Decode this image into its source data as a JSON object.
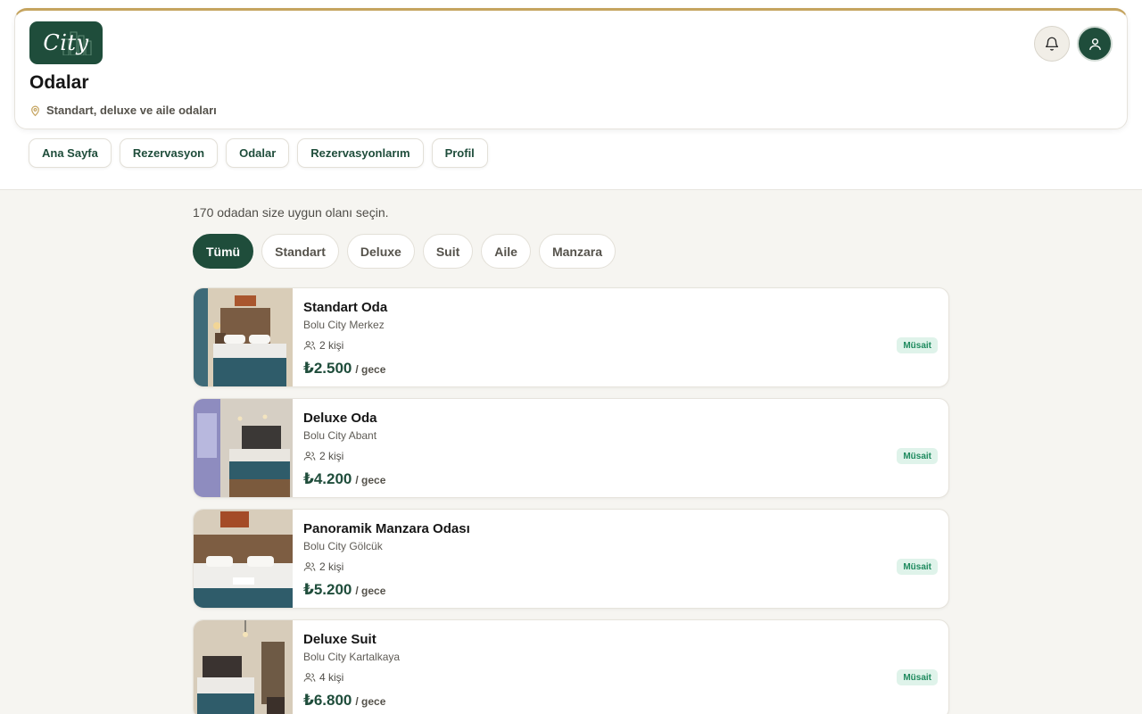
{
  "header": {
    "logo_text": "City",
    "title": "Odalar",
    "subtitle": "Standart, deluxe ve aile odaları"
  },
  "nav": {
    "items": [
      {
        "label": "Ana Sayfa"
      },
      {
        "label": "Rezervasyon"
      },
      {
        "label": "Odalar"
      },
      {
        "label": "Rezervasyonlarım"
      },
      {
        "label": "Profil"
      }
    ]
  },
  "main": {
    "count_text": "170 odadan size uygun olanı seçin.",
    "filters": [
      {
        "label": "Tümü",
        "active": true
      },
      {
        "label": "Standart",
        "active": false
      },
      {
        "label": "Deluxe",
        "active": false
      },
      {
        "label": "Suit",
        "active": false
      },
      {
        "label": "Aile",
        "active": false
      },
      {
        "label": "Manzara",
        "active": false
      }
    ],
    "rooms": [
      {
        "title": "Standart Oda",
        "location": "Bolu City Merkez",
        "capacity": "2 kişi",
        "price": "₺2.500",
        "unit": "/ gece",
        "status": "Müsait"
      },
      {
        "title": "Deluxe Oda",
        "location": "Bolu City Abant",
        "capacity": "2 kişi",
        "price": "₺4.200",
        "unit": "/ gece",
        "status": "Müsait"
      },
      {
        "title": "Panoramik Manzara Odası",
        "location": "Bolu City Gölcük",
        "capacity": "2 kişi",
        "price": "₺5.200",
        "unit": "/ gece",
        "status": "Müsait"
      },
      {
        "title": "Deluxe Suit",
        "location": "Bolu City Kartalkaya",
        "capacity": "4 kişi",
        "price": "₺6.800",
        "unit": "/ gece",
        "status": "Müsait"
      }
    ]
  },
  "icons": {
    "location": "map-pin-icon",
    "notifications": "bell-icon",
    "profile": "user-icon",
    "capacity": "users-icon"
  },
  "colors": {
    "brand": "#1f4d3b",
    "accent": "#c5a45f",
    "available": "#1e8a5e",
    "available_bg": "#dff3ea"
  }
}
